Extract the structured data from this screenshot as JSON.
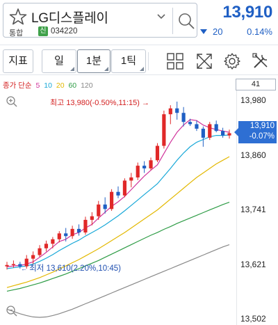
{
  "stock": {
    "name": "LG디스플레이",
    "market": "통합",
    "credit_badge": "신",
    "code": "034220"
  },
  "quote": {
    "price": "13,910",
    "change": "20",
    "change_pct": "0.14%"
  },
  "toolbar": {
    "indicator_label": "지표",
    "period_day": "일",
    "period_1min": "1분",
    "period_tick": "1틱"
  },
  "indicator": {
    "prefix": "종가 단순",
    "ma": [
      {
        "label": "5",
        "color": "#d0339b"
      },
      {
        "label": "10",
        "color": "#18a8d8"
      },
      {
        "label": "20",
        "color": "#e3b800"
      },
      {
        "label": "60",
        "color": "#2e9c46"
      },
      {
        "label": "120",
        "color": "#888888"
      }
    ],
    "count": "41"
  },
  "annotations": {
    "high_label": "최고",
    "high_value": "13,980(-0.50%,11:15)",
    "low_label": "최저",
    "low_value": "13,610(2.20%,10:45)"
  },
  "price_tag": {
    "price": "13,910",
    "pct": "-0.07%"
  },
  "colors": {
    "up": "#e02828",
    "down": "#1f5fc4",
    "accent": "#1f5fc4"
  },
  "chart_data": {
    "type": "candlestick",
    "y_ticks": [
      "13,980",
      "13,860",
      "13,741",
      "13,621",
      "13,502"
    ],
    "ylim": [
      13502,
      13980
    ],
    "candles": [
      {
        "o": 13615,
        "h": 13625,
        "l": 13608,
        "c": 13618
      },
      {
        "o": 13618,
        "h": 13628,
        "l": 13612,
        "c": 13620
      },
      {
        "o": 13620,
        "h": 13625,
        "l": 13610,
        "c": 13615
      },
      {
        "o": 13615,
        "h": 13640,
        "l": 13610,
        "c": 13632
      },
      {
        "o": 13632,
        "h": 13648,
        "l": 13620,
        "c": 13640
      },
      {
        "o": 13640,
        "h": 13662,
        "l": 13636,
        "c": 13655
      },
      {
        "o": 13655,
        "h": 13672,
        "l": 13648,
        "c": 13665
      },
      {
        "o": 13665,
        "h": 13680,
        "l": 13655,
        "c": 13675
      },
      {
        "o": 13675,
        "h": 13693,
        "l": 13668,
        "c": 13688
      },
      {
        "o": 13688,
        "h": 13700,
        "l": 13670,
        "c": 13682
      },
      {
        "o": 13682,
        "h": 13705,
        "l": 13676,
        "c": 13698
      },
      {
        "o": 13698,
        "h": 13708,
        "l": 13683,
        "c": 13690
      },
      {
        "o": 13690,
        "h": 13725,
        "l": 13685,
        "c": 13718
      },
      {
        "o": 13718,
        "h": 13735,
        "l": 13706,
        "c": 13726
      },
      {
        "o": 13726,
        "h": 13760,
        "l": 13718,
        "c": 13752
      },
      {
        "o": 13752,
        "h": 13768,
        "l": 13732,
        "c": 13742
      },
      {
        "o": 13742,
        "h": 13786,
        "l": 13738,
        "c": 13780
      },
      {
        "o": 13780,
        "h": 13792,
        "l": 13766,
        "c": 13772
      },
      {
        "o": 13772,
        "h": 13810,
        "l": 13768,
        "c": 13805
      },
      {
        "o": 13805,
        "h": 13822,
        "l": 13790,
        "c": 13812
      },
      {
        "o": 13812,
        "h": 13845,
        "l": 13806,
        "c": 13838
      },
      {
        "o": 13838,
        "h": 13848,
        "l": 13822,
        "c": 13832
      },
      {
        "o": 13832,
        "h": 13856,
        "l": 13828,
        "c": 13850
      },
      {
        "o": 13850,
        "h": 13888,
        "l": 13846,
        "c": 13882
      },
      {
        "o": 13882,
        "h": 13960,
        "l": 13876,
        "c": 13952
      },
      {
        "o": 13952,
        "h": 13972,
        "l": 13930,
        "c": 13965
      },
      {
        "o": 13965,
        "h": 13980,
        "l": 13940,
        "c": 13955
      },
      {
        "o": 13955,
        "h": 13968,
        "l": 13925,
        "c": 13935
      },
      {
        "o": 13935,
        "h": 13942,
        "l": 13926,
        "c": 13930
      },
      {
        "o": 13930,
        "h": 13938,
        "l": 13915,
        "c": 13920
      },
      {
        "o": 13920,
        "h": 13925,
        "l": 13880,
        "c": 13900
      },
      {
        "o": 13900,
        "h": 13935,
        "l": 13895,
        "c": 13930
      },
      {
        "o": 13930,
        "h": 13938,
        "l": 13912,
        "c": 13915
      },
      {
        "o": 13915,
        "h": 13922,
        "l": 13900,
        "c": 13905
      },
      {
        "o": 13905,
        "h": 13918,
        "l": 13898,
        "c": 13910
      }
    ],
    "ma5": [
      13614,
      13616,
      13617,
      13620,
      13625,
      13635,
      13646,
      13658,
      13670,
      13675,
      13685,
      13690,
      13700,
      13708,
      13722,
      13735,
      13748,
      13758,
      13770,
      13785,
      13800,
      13815,
      13828,
      13840,
      13865,
      13890,
      13912,
      13928,
      13940,
      13938,
      13928,
      13922,
      13918,
      13915,
      13912
    ],
    "ma10": [
      13610,
      13612,
      13614,
      13616,
      13620,
      13626,
      13633,
      13641,
      13650,
      13658,
      13666,
      13673,
      13682,
      13690,
      13698,
      13707,
      13717,
      13727,
      13738,
      13750,
      13762,
      13774,
      13786,
      13798,
      13815,
      13832,
      13850,
      13866,
      13880,
      13890,
      13896,
      13902,
      13905,
      13905,
      13906
    ],
    "ma20": [
      13568,
      13572,
      13576,
      13580,
      13585,
      13590,
      13596,
      13602,
      13609,
      13616,
      13623,
      13630,
      13638,
      13646,
      13654,
      13663,
      13672,
      13681,
      13690,
      13700,
      13710,
      13720,
      13730,
      13740,
      13752,
      13764,
      13776,
      13788,
      13800,
      13812,
      13822,
      13832,
      13842,
      13850,
      13858
    ],
    "ma60": [
      13560,
      13563,
      13566,
      13570,
      13574,
      13578,
      13583,
      13588,
      13593,
      13598,
      13604,
      13610,
      13616,
      13622,
      13628,
      13635,
      13642,
      13649,
      13656,
      13663,
      13670,
      13677,
      13684,
      13690,
      13697,
      13703,
      13710,
      13716,
      13722,
      13728,
      13734,
      13740,
      13746,
      13752,
      13757
    ],
    "ma120": [
      13520,
      13515,
      13510,
      13506,
      13503,
      13502,
      13503,
      13506,
      13510,
      13515,
      13520,
      13526,
      13532,
      13538,
      13544,
      13550,
      13556,
      13562,
      13568,
      13574,
      13580,
      13586,
      13592,
      13598,
      13604,
      13610,
      13616,
      13622,
      13628,
      13634,
      13640,
      13646,
      13652,
      13658,
      13663
    ]
  }
}
